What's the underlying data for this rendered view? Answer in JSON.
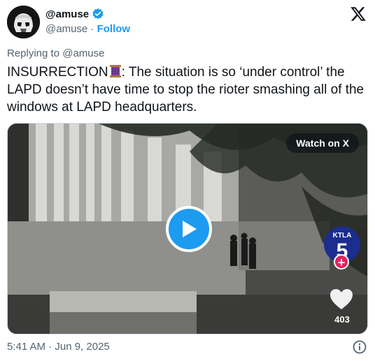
{
  "author": {
    "display_name": "@amuse",
    "handle": "@amuse",
    "separator": "·",
    "follow_label": "Follow",
    "verified_color": "#1d9bf0"
  },
  "replying_to": "Replying to @amuse",
  "tweet": {
    "text_before": "INSURRECTION",
    "emoji": "spool-of-thread",
    "text_after": ": The situation is so ‘under control’ the LAPD doesn’t have time to stop the rioter smashing all of the windows at LAPD headquarters."
  },
  "media": {
    "watch_label": "Watch on X",
    "play_icon": "play-icon",
    "channel_badge": "KTLA 5",
    "like_count": "403",
    "accent": "#1d9bf0"
  },
  "footer": {
    "timestamp": "5:41 AM · Jun 9, 2025",
    "info_icon": "info-icon"
  }
}
